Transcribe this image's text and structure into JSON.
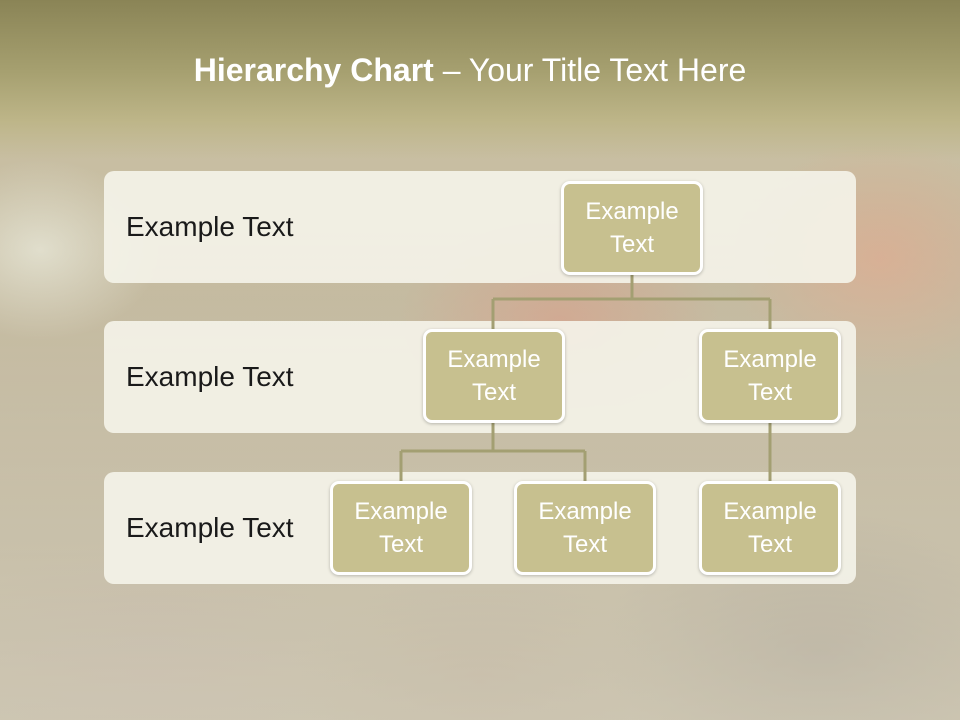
{
  "slide": {
    "title_bold": "Hierarchy Chart",
    "title_rest": " – Your Title Text Here"
  },
  "levels": [
    {
      "label": "Example Text"
    },
    {
      "label": "Example Text"
    },
    {
      "label": "Example Text"
    }
  ],
  "nodes": {
    "root": "Example\nText",
    "child_left": "Example\nText",
    "child_right": "Example\nText",
    "grandchild_1": "Example\nText",
    "grandchild_2": "Example\nText",
    "grandchild_3": "Example\nText"
  },
  "colors": {
    "node_fill": "#c7c08f",
    "connector": "#a39f72",
    "header": "#a6a070"
  }
}
